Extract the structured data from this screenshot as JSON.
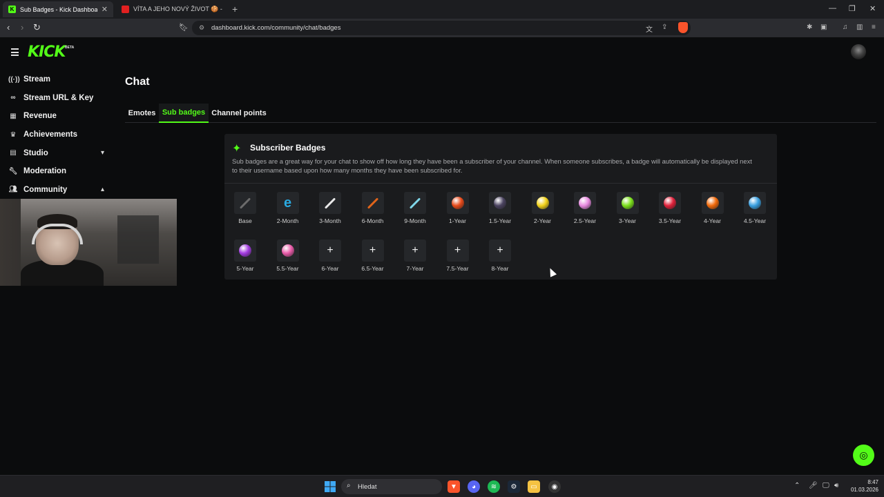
{
  "browser": {
    "tabs": [
      {
        "title": "Sub Badges - Kick Dashboard",
        "active": true
      },
      {
        "title": "VÍTA A JEHO NOVÝ ŽIVOT 🍪 - YouT",
        "active": false
      }
    ],
    "url": "dashboard.kick.com/community/chat/badges"
  },
  "header": {
    "logo": "KICK",
    "logo_tag": "BETA"
  },
  "sidebar": {
    "items": [
      {
        "label": "Stream",
        "icon": "broadcast-icon"
      },
      {
        "label": "Stream URL & Key",
        "icon": "link-icon"
      },
      {
        "label": "Revenue",
        "icon": "chart-icon"
      },
      {
        "label": "Achievements",
        "icon": "trophy-icon"
      },
      {
        "label": "Studio",
        "icon": "film-icon",
        "chevron": "down"
      },
      {
        "label": "Moderation",
        "icon": "wrench-icon"
      },
      {
        "label": "Community",
        "icon": "users-icon",
        "chevron": "up"
      }
    ]
  },
  "main": {
    "title": "Chat",
    "tabs": [
      {
        "label": "Emotes"
      },
      {
        "label": "Sub badges",
        "active": true
      },
      {
        "label": "Channel points"
      }
    ],
    "card": {
      "heading": "Subscriber Badges",
      "description": "Sub badges are a great way for your chat to show off how long they have been a subscriber of your channel. When someone subscribes, a badge will automatically be displayed next to their username based upon how many months they have been subscribed for.",
      "badges": [
        {
          "label": "Base",
          "kind": "sword",
          "color": "#6b6b6b"
        },
        {
          "label": "2-Month",
          "kind": "glyph",
          "color": "#2aa9e0"
        },
        {
          "label": "3-Month",
          "kind": "sword",
          "color": "#e8e8e8"
        },
        {
          "label": "6-Month",
          "kind": "sword",
          "color": "#e0641a"
        },
        {
          "label": "9-Month",
          "kind": "sword",
          "color": "#7fd6e8"
        },
        {
          "label": "1-Year",
          "kind": "orb",
          "color": "#e84a1a"
        },
        {
          "label": "1.5-Year",
          "kind": "orb",
          "color": "#4a4360"
        },
        {
          "label": "2-Year",
          "kind": "orb",
          "color": "#f2d21a"
        },
        {
          "label": "2.5-Year",
          "kind": "orb",
          "color": "#e88ae0"
        },
        {
          "label": "3-Year",
          "kind": "orb",
          "color": "#7ae01a"
        },
        {
          "label": "3.5-Year",
          "kind": "orb",
          "color": "#e0203a"
        },
        {
          "label": "4-Year",
          "kind": "orb",
          "color": "#f26a0a"
        },
        {
          "label": "4.5-Year",
          "kind": "orb",
          "color": "#3aa0e0"
        },
        {
          "label": "5-Year",
          "kind": "orb",
          "color": "#a23ae0"
        },
        {
          "label": "5.5-Year",
          "kind": "orb",
          "color": "#e85aa8"
        },
        {
          "label": "6-Year",
          "kind": "empty"
        },
        {
          "label": "6.5-Year",
          "kind": "empty"
        },
        {
          "label": "7-Year",
          "kind": "empty"
        },
        {
          "label": "7.5-Year",
          "kind": "empty"
        },
        {
          "label": "8-Year",
          "kind": "empty"
        }
      ]
    }
  },
  "taskbar": {
    "search_placeholder": "Hledat",
    "time": "8:47",
    "date": "01.03.2026"
  },
  "colors": {
    "accent": "#53fc18",
    "background": "#0b0c0d",
    "card": "#1a1b1d"
  }
}
